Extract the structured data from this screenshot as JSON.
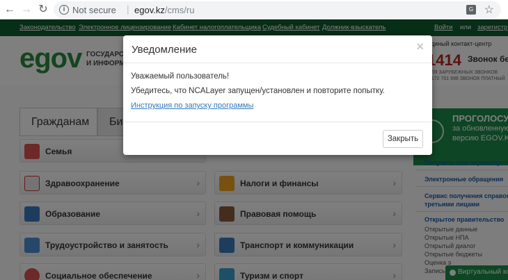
{
  "browser": {
    "back_icon": "←",
    "forward_icon": "→",
    "reload_icon": "↻",
    "security_label": "Not secure",
    "separator": "|",
    "url_host": "egov.kz",
    "url_path": "/cms/ru"
  },
  "topnav": {
    "links": [
      "Законодательство",
      "Электронное лицензирование",
      "Кабинет налогоплательщика",
      "Судебный кабинет",
      "Должник-взыскатель"
    ],
    "login": "Войти",
    "or": "или",
    "register": "зарегистр"
  },
  "header": {
    "logo": "egov",
    "subtitle_line1": "ГОСУДАРСТ",
    "subtitle_line2": "И ИНФОРМА",
    "contact_title": "единый контакт-центр",
    "phone": "1414",
    "phone_label": "Звонок бесплат",
    "phone_note1": "ДЛЯ ЗАРУБЕЖНЫХ ЗВОНКОВ",
    "phone_note2": "7 172 701 998 ЗВОНОК ПЛАТНЫЙ"
  },
  "tabs": [
    "Гражданам",
    "Би"
  ],
  "categories": {
    "left": [
      "Семья",
      "Здравоохранение",
      "Образование",
      "Трудоустройство и занятость",
      "Социальное обеспечение"
    ],
    "right": [
      "Налоги и финансы",
      "Правовая помощь",
      "Транспорт и коммуникации",
      "Туризм и спорт"
    ]
  },
  "banner": {
    "line1": "ПРОГОЛОСУЙ",
    "line2": "за обновленную",
    "line3": "версию EGOV.KZ"
  },
  "sidebar": {
    "links": [
      "Получить или перевыпустить",
      "Электронные обращения",
      "Сервис получения справок",
      "третьими лицами"
    ],
    "section_title": "Открытое правительство",
    "sub_links": [
      "Открытые данные",
      "Открытые НПА",
      "Открытый диалог",
      "Открытые бюджеты",
      "Оценка э",
      "Запись"
    ]
  },
  "chat": {
    "label": "Виртуальный конс"
  },
  "modal": {
    "title": "Уведомление",
    "close_symbol": "×",
    "line1": "Уважаемый пользователь!",
    "line2": "Убедитесь, что NCALayer запущен/установлен и повторите попытку.",
    "link": "Инструкция по запуску программы",
    "close_button": "Закрыть"
  }
}
